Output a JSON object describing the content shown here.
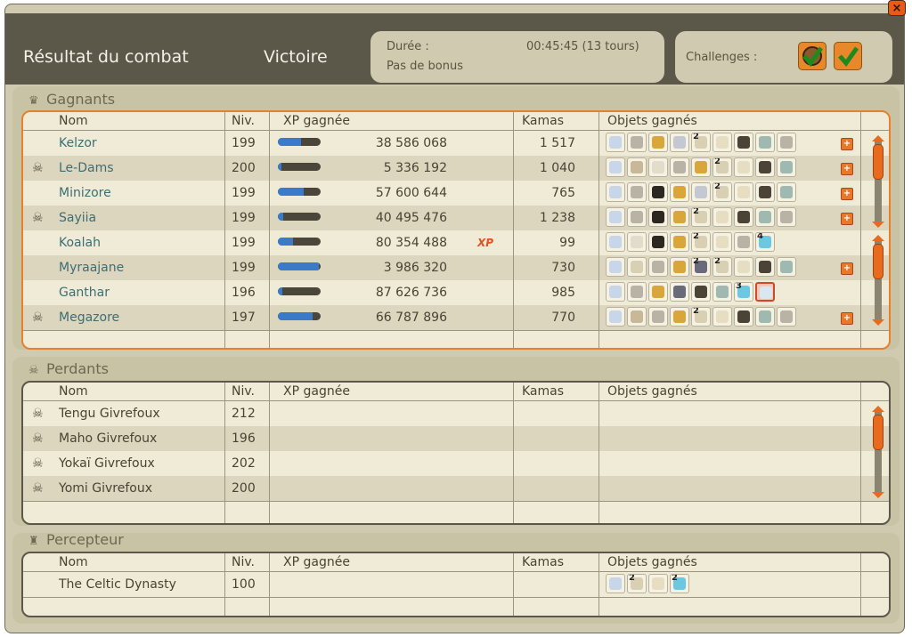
{
  "window": {
    "title": "Résultat du combat",
    "result": "Victoire",
    "duration_label": "Durée :",
    "duration_value": "00:45:45 (13 tours)",
    "bonus": "Pas de bonus",
    "challenges_label": "Challenges :",
    "close_label": "×"
  },
  "columns": {
    "name": "Nom",
    "level": "Niv.",
    "xp": "XP gagnée",
    "kamas": "Kamas",
    "items": "Objets gagnés"
  },
  "winners": {
    "title": "Gagnants",
    "rows": [
      {
        "name": "Kelzor",
        "level": "199",
        "xp": "38 586 068",
        "kamas": "1 517",
        "xp_fill": 0.55,
        "dead": false,
        "xp_bonus": false,
        "items": [
          "fan",
          "cloud",
          "chest",
          "shield",
          "bone",
          "tooth",
          "wing",
          "stone",
          "cloud"
        ],
        "qty": [
          "",
          "",
          "",
          "",
          "2",
          "",
          "",
          "",
          ""
        ],
        "more": true
      },
      {
        "name": "Le-Dams",
        "level": "200",
        "xp": "5 336 192",
        "kamas": "1 040",
        "xp_fill": 0.08,
        "dead": true,
        "xp_bonus": false,
        "items": [
          "fan",
          "scroll",
          "skull",
          "cloud",
          "chest",
          "bone",
          "tooth",
          "wing",
          "stone"
        ],
        "qty": [
          "",
          "",
          "",
          "",
          "",
          "2",
          "",
          "",
          ""
        ],
        "more": true
      },
      {
        "name": "Minizore",
        "level": "199",
        "xp": "57 600 644",
        "kamas": "765",
        "xp_fill": 0.6,
        "dead": false,
        "xp_bonus": false,
        "items": [
          "fan",
          "cloud",
          "hat",
          "chest",
          "shield",
          "bone",
          "tooth",
          "wing",
          "stone"
        ],
        "qty": [
          "",
          "",
          "",
          "",
          "",
          "2",
          "",
          "",
          ""
        ],
        "more": true
      },
      {
        "name": "Sayiia",
        "level": "199",
        "xp": "40 495 476",
        "kamas": "1 238",
        "xp_fill": 0.12,
        "dead": true,
        "xp_bonus": false,
        "items": [
          "fan",
          "cloud",
          "hat",
          "chest",
          "bone",
          "tooth",
          "wing",
          "stone",
          "cloud"
        ],
        "qty": [
          "",
          "",
          "",
          "",
          "2",
          "",
          "",
          "",
          ""
        ],
        "more": true
      },
      {
        "name": "Koalah",
        "level": "199",
        "xp": "80 354 488",
        "kamas": "99",
        "xp_fill": 0.35,
        "dead": false,
        "xp_bonus": true,
        "items": [
          "fan",
          "skull",
          "hat",
          "chest",
          "bone",
          "tooth",
          "cloud",
          "potion"
        ],
        "qty": [
          "",
          "",
          "",
          "",
          "2",
          "",
          "",
          "4"
        ],
        "more": false
      },
      {
        "name": "Myraajane",
        "level": "199",
        "xp": "3 986 320",
        "kamas": "730",
        "xp_fill": 0.95,
        "dead": false,
        "xp_bonus": false,
        "items": [
          "fan",
          "bone",
          "cloud",
          "chest",
          "feather",
          "bone",
          "tooth",
          "wing",
          "stone"
        ],
        "qty": [
          "",
          "",
          "",
          "",
          "2",
          "2",
          "",
          "",
          ""
        ],
        "more": true
      },
      {
        "name": "Ganthar",
        "level": "196",
        "xp": "87 626 736",
        "kamas": "985",
        "xp_fill": 0.1,
        "dead": false,
        "xp_bonus": false,
        "items": [
          "fan",
          "cloud",
          "chest",
          "feather",
          "wing",
          "stone",
          "potion",
          "ghost"
        ],
        "qty": [
          "",
          "",
          "",
          "",
          "",
          "",
          "3",
          ""
        ],
        "more": false
      },
      {
        "name": "Megazore",
        "level": "197",
        "xp": "66 787 896",
        "kamas": "770",
        "xp_fill": 0.82,
        "dead": true,
        "xp_bonus": false,
        "items": [
          "fan",
          "scroll",
          "cloud",
          "chest",
          "bone",
          "tooth",
          "wing",
          "stone",
          "cloud"
        ],
        "qty": [
          "",
          "",
          "",
          "",
          "2",
          "",
          "",
          "",
          ""
        ],
        "more": true
      }
    ]
  },
  "losers": {
    "title": "Perdants",
    "rows": [
      {
        "name": "Tengu Givrefoux",
        "level": "212"
      },
      {
        "name": "Maho Givrefoux",
        "level": "196"
      },
      {
        "name": "Yokaï Givrefoux",
        "level": "202"
      },
      {
        "name": "Yomi Givrefoux",
        "level": "200"
      }
    ]
  },
  "collector": {
    "title": "Percepteur",
    "rows": [
      {
        "name": "The Celtic Dynasty",
        "level": "100",
        "items": [
          "fan",
          "bone",
          "tooth",
          "potion"
        ],
        "qty": [
          "",
          "2",
          "",
          "2"
        ]
      }
    ]
  },
  "icon_colors": {
    "fan": "#c8d6ea",
    "cloud": "#b9b3a6",
    "chest": "#d8a63a",
    "shield": "#c4c8d2",
    "bone": "#d9d0b4",
    "tooth": "#e7dec2",
    "wing": "#4b4336",
    "stone": "#9fb8b0",
    "scroll": "#c8b898",
    "skull": "#e2dccb",
    "hat": "#2c2820",
    "potion": "#6cc8e0",
    "feather": "#6a6a7a",
    "ghost": "#d9e7f0"
  },
  "accent": "#e87f2a"
}
